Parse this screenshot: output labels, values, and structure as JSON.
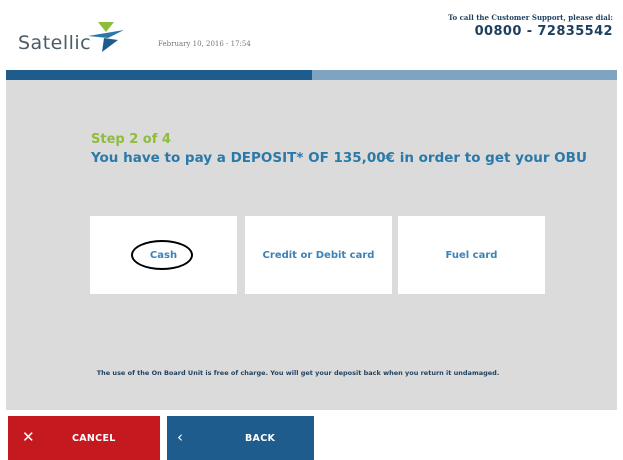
{
  "header": {
    "logo_text": "Satellic",
    "date": "February 10, 2016 - 17:54",
    "support_label": "To call the Customer Support, please dial:",
    "support_phone": "00800 - 72835542"
  },
  "progress": {
    "current_step": 2,
    "total_steps": 4
  },
  "main": {
    "step": "Step 2 of 4",
    "instruction": "You have to pay a DEPOSIT* OF 135,00€ in order to get your OBU",
    "options": [
      {
        "label": "Cash"
      },
      {
        "label": "Credit or Debit card"
      },
      {
        "label": "Fuel card"
      }
    ],
    "note": "The use of the On Board Unit is free of charge. You will get your deposit back when you return it undamaged."
  },
  "footer": {
    "cancel_label": "CANCEL",
    "back_label": "BACK"
  },
  "colors": {
    "accent_blue": "#1f5c8e",
    "cancel_red": "#c41a1f",
    "step_green": "#8dbd3a",
    "instruction_blue": "#2a79a8"
  },
  "icons": {
    "logo": "satellic-logo-icon",
    "cancel": "close-icon",
    "back": "chevron-left-icon"
  }
}
